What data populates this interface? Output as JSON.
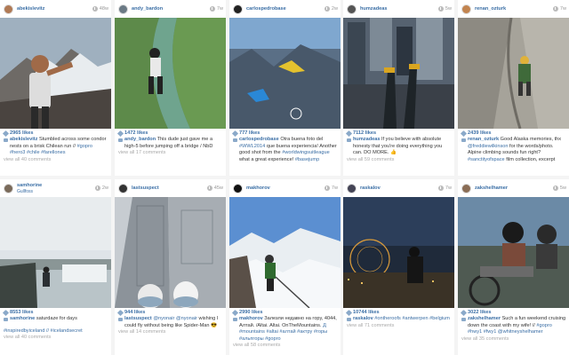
{
  "posts": [
    {
      "user": "abekislevitz",
      "time": "48w",
      "likes": "2965 likes",
      "caption_user": "abekislevitz",
      "caption": " Stumbled across some condor nests on a brisk Chilean run // ",
      "tags": "#gopro #hero3 #chile #farellones",
      "view_all": "view all 40 comments",
      "location": ""
    },
    {
      "user": "andy_bardon",
      "time": "7w",
      "likes": "1472 likes",
      "caption_user": "andy_bardon",
      "caption": " This dude just gave me a high-5 before jumping off a bridge / NbD",
      "tags": "",
      "view_all": "view all 17 comments",
      "location": ""
    },
    {
      "user": "carlospedrobase",
      "time": "2w",
      "likes": "777 likes",
      "caption_user": "carlospedrobase",
      "caption": " Otra buena foto del ",
      "tags": "#WWL2014",
      "caption2": " que buena experiencia! Another good shot from the ",
      "tags2": "#worldwingsuitleague",
      "caption3": " what a great experience! ",
      "tags3": "#basejump",
      "view_all": "",
      "location": ""
    },
    {
      "user": "humzadeas",
      "time": "5w",
      "likes": "7112 likes",
      "caption_user": "humzadeas",
      "caption": " If you believe with absolute honesty that you're doing everything you can. DO MORE. ",
      "tags": "👍",
      "view_all": "view all 59 comments",
      "location": ""
    },
    {
      "user": "renan_ozturk",
      "time": "7w",
      "likes": "2439 likes",
      "caption_user": "renan_ozturk",
      "caption": " Good Alaska memories, thx ",
      "tags": "@freddiewilkinson",
      "caption2": " for the words/photo. Alpine climbing sounds fun right? ",
      "tags2": "#sanctityofspace",
      "caption3": " film collection, excerpt",
      "tags3": "",
      "view_all": "",
      "location": ""
    },
    {
      "user": "samhorine",
      "time": "2w",
      "likes": "8553 likes",
      "caption_user": "samhorine",
      "caption": " saturdaze for days",
      "tags": "",
      "tags_line": "#inspiredbyiceland // #icelandsecret",
      "view_all": "view all 40 comments",
      "location": "Gullfoss"
    },
    {
      "user": "lastsuspect",
      "time": "45w",
      "likes": "944 likes",
      "caption_user": "lastsuspect",
      "caption": " ",
      "tags": "@nyonair",
      "caption2": " ",
      "tags2": "@nyonair",
      "caption3": " wishing I could fly without being like Spider-Man ",
      "tags3": "😎",
      "view_all": "view all 14 comments",
      "location": ""
    },
    {
      "user": "makhorov",
      "time": "7w",
      "likes": "2990 likes",
      "caption_user": "makhorov",
      "caption": " Залезли недавно на гору, 4044, Алтай. /Altai. Altai. OnTheMountains. ",
      "tags": "Д #mountains #altai #алтай #актру #горы #альпгоры #gopro",
      "view_all": "view all 58 comments",
      "location": ""
    },
    {
      "user": "raskalov",
      "time": "7w",
      "likes": "10744 likes",
      "caption_user": "raskalov",
      "caption": " ",
      "tags": "#ontheroofs #antwerpen #belgium",
      "view_all": "view all 71 comments",
      "location": ""
    },
    {
      "user": "zakshelhamer",
      "time": "5w",
      "likes": "3022 likes",
      "caption_user": "zakshelhamer",
      "caption": " Such a fun weekend cruising down the coast with my wife! // ",
      "tags": "#gopro #hwy1 #fwy1 @whitneyshelhamer",
      "view_all": "view all 35 comments",
      "location": ""
    }
  ],
  "colors": {
    "accent": "#3a6ea5",
    "muted": "#999999",
    "background": "#f4f4f4"
  },
  "icons": {
    "timestamp": "clock-icon",
    "likes": "heart-icon",
    "comment": "comment-icon"
  }
}
